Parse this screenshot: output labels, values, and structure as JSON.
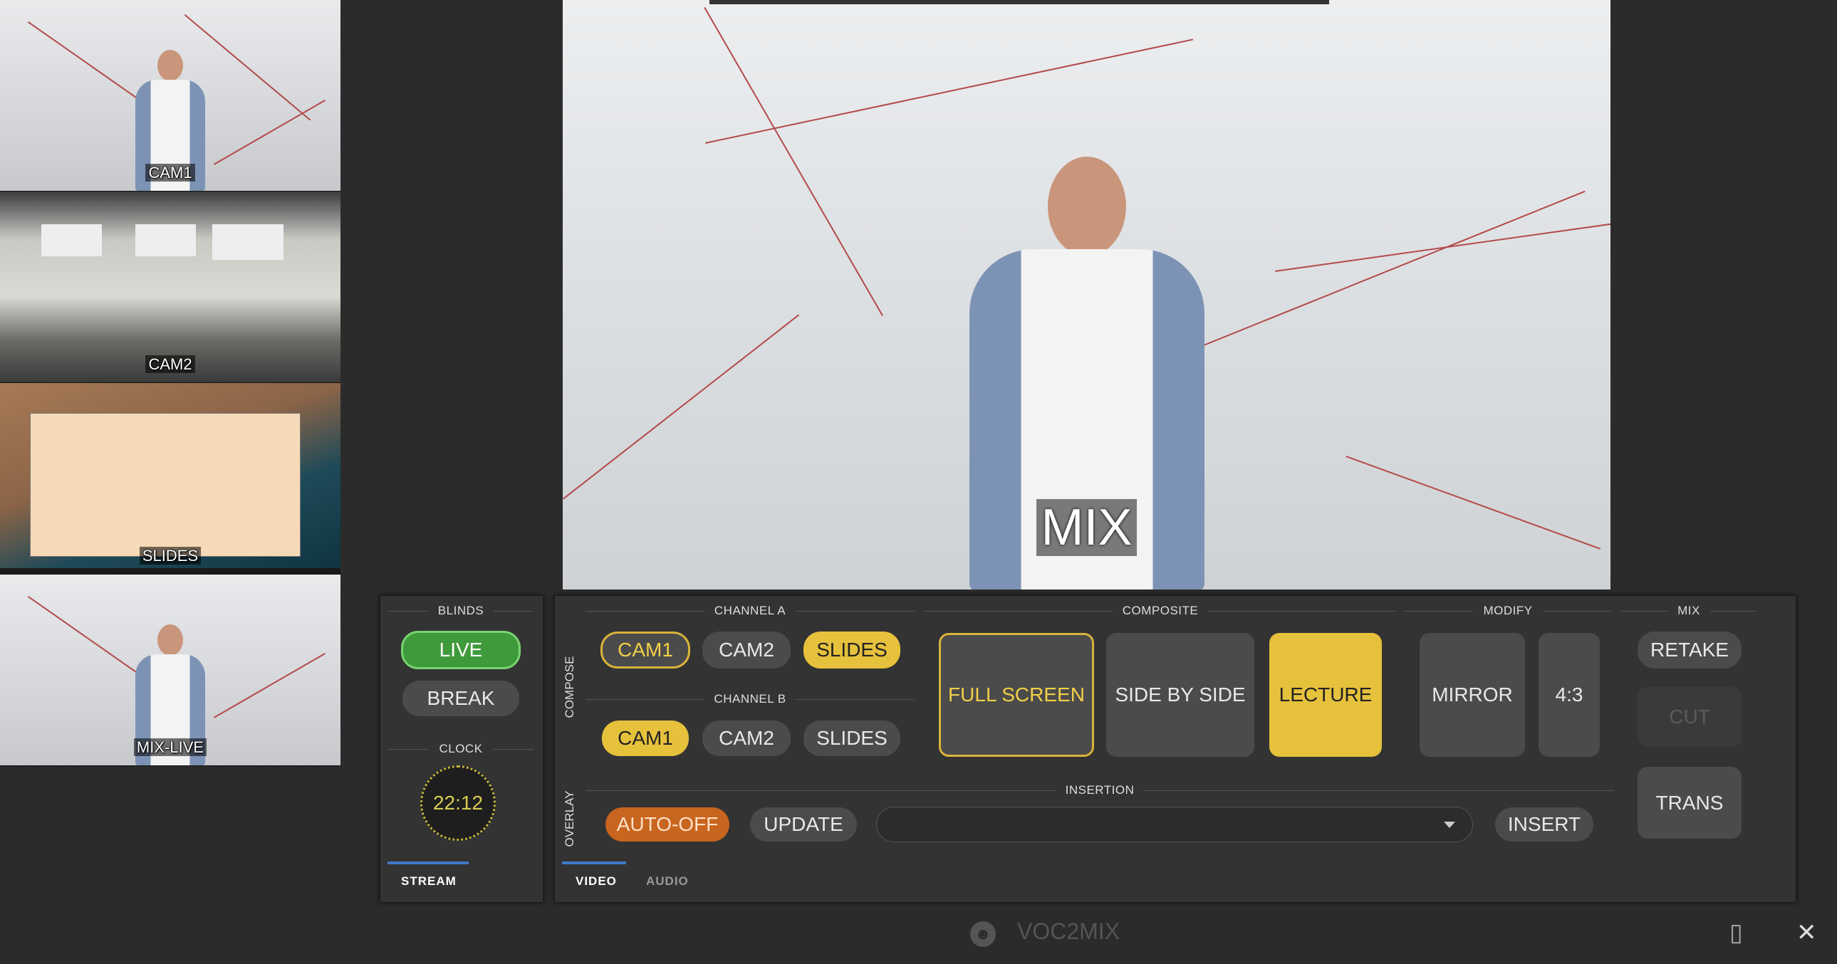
{
  "previews": [
    {
      "label": "CAM1"
    },
    {
      "label": "CAM2"
    },
    {
      "label": "SLIDES"
    },
    {
      "label": "MIX-LIVE"
    }
  ],
  "monitor": {
    "label": "MIX"
  },
  "left_panel": {
    "blinds_title": "BLINDS",
    "live_label": "LIVE",
    "break_label": "BREAK",
    "clock_title": "CLOCK",
    "clock_time": "22:12",
    "tab_stream": "STREAM"
  },
  "compose": {
    "side_label": "COMPOSE",
    "channel_a_title": "CHANNEL A",
    "channel_b_title": "CHANNEL B",
    "channel_a": [
      "CAM1",
      "CAM2",
      "SLIDES"
    ],
    "channel_b": [
      "CAM1",
      "CAM2",
      "SLIDES"
    ],
    "composite_title": "COMPOSITE",
    "composite": [
      "FULL SCREEN",
      "SIDE BY SIDE",
      "LECTURE"
    ],
    "modify_title": "MODIFY",
    "modify": [
      "MIRROR",
      "4:3"
    ],
    "mix_title": "MIX",
    "mix": [
      "RETAKE",
      "CUT",
      "TRANS"
    ]
  },
  "overlay": {
    "side_label": "OVERLAY",
    "insertion_title": "INSERTION",
    "auto_off_label": "AUTO-OFF",
    "update_label": "UPDATE",
    "insert_label": "INSERT"
  },
  "tabs": {
    "video": "VIDEO",
    "audio": "AUDIO"
  },
  "footer": {
    "app_title": "VOC2MIX"
  },
  "colors": {
    "accent_yellow": "#e6c13c",
    "live_green": "#3f9a3c",
    "orange": "#c8651e",
    "tab_blue": "#3f79c8"
  },
  "icons": {
    "app_logo": "voc-logo-icon",
    "collapse": "collapse-icon",
    "close": "close-icon"
  }
}
